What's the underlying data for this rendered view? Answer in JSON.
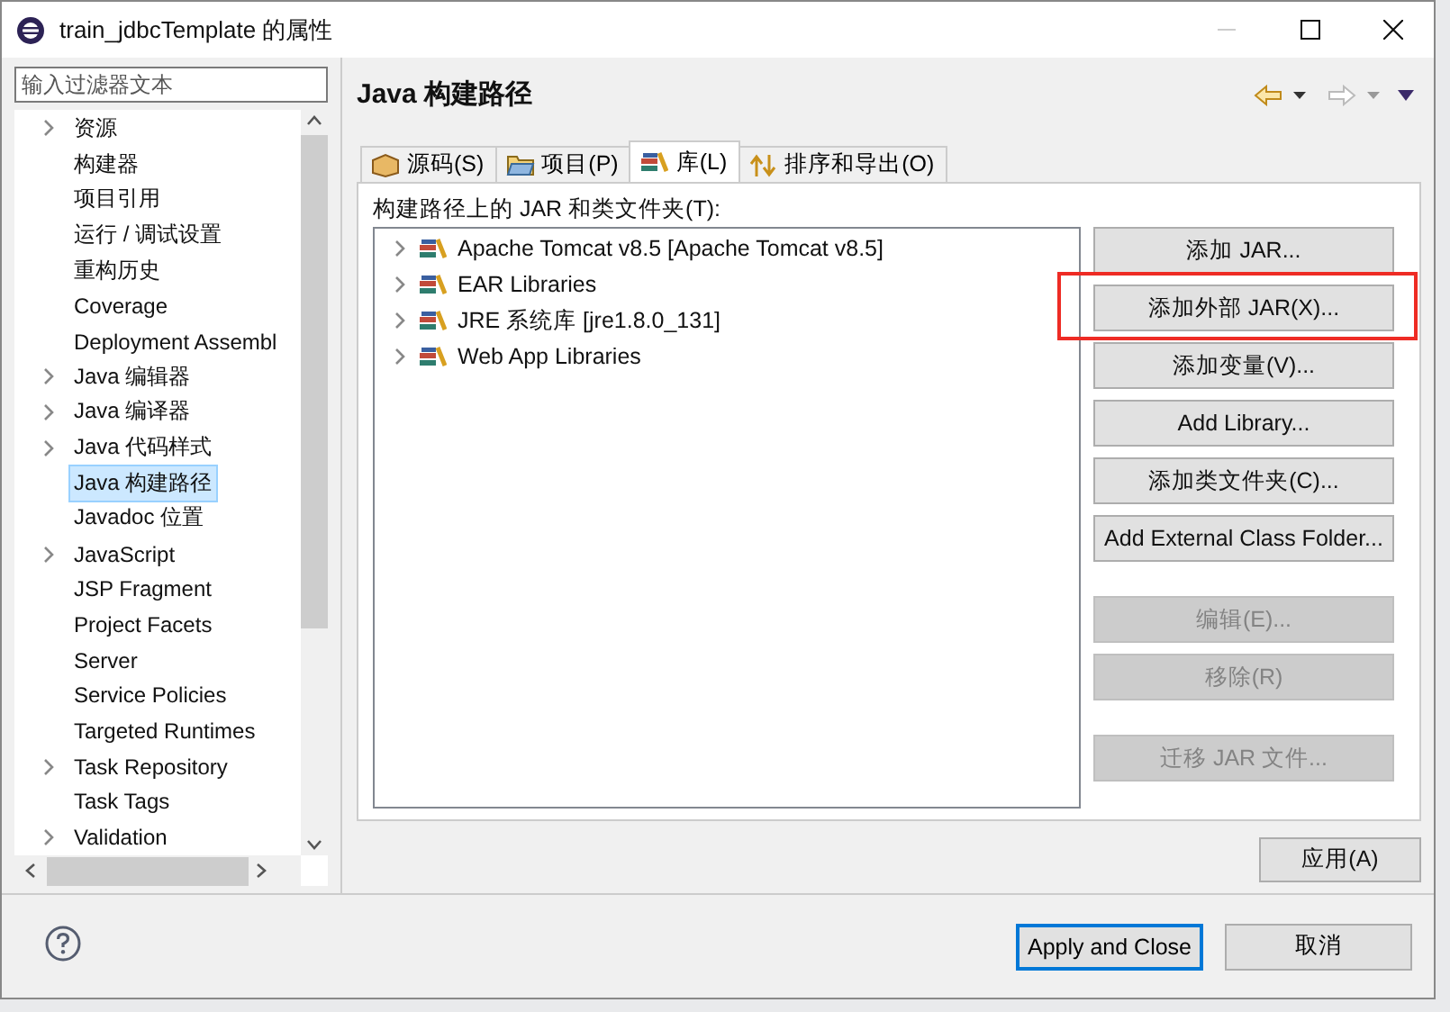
{
  "window": {
    "title": "train_jdbcTemplate 的属性"
  },
  "filter": {
    "placeholder": "输入过滤器文本"
  },
  "tree": {
    "items": [
      {
        "label": "资源",
        "expandable": true,
        "selected": false
      },
      {
        "label": "构建器",
        "expandable": false,
        "selected": false
      },
      {
        "label": "项目引用",
        "expandable": false,
        "selected": false
      },
      {
        "label": "运行 / 调试设置",
        "expandable": false,
        "selected": false
      },
      {
        "label": "重构历史",
        "expandable": false,
        "selected": false
      },
      {
        "label": "Coverage",
        "expandable": false,
        "selected": false
      },
      {
        "label": "Deployment Assembl",
        "expandable": false,
        "selected": false
      },
      {
        "label": "Java 编辑器",
        "expandable": true,
        "selected": false
      },
      {
        "label": "Java 编译器",
        "expandable": true,
        "selected": false
      },
      {
        "label": "Java 代码样式",
        "expandable": true,
        "selected": false
      },
      {
        "label": "Java 构建路径",
        "expandable": false,
        "selected": true
      },
      {
        "label": "Javadoc 位置",
        "expandable": false,
        "selected": false
      },
      {
        "label": "JavaScript",
        "expandable": true,
        "selected": false
      },
      {
        "label": "JSP Fragment",
        "expandable": false,
        "selected": false
      },
      {
        "label": "Project Facets",
        "expandable": false,
        "selected": false
      },
      {
        "label": "Server",
        "expandable": false,
        "selected": false
      },
      {
        "label": "Service Policies",
        "expandable": false,
        "selected": false
      },
      {
        "label": "Targeted Runtimes",
        "expandable": false,
        "selected": false
      },
      {
        "label": "Task Repository",
        "expandable": true,
        "selected": false
      },
      {
        "label": "Task Tags",
        "expandable": false,
        "selected": false
      },
      {
        "label": "Validation",
        "expandable": true,
        "selected": false
      }
    ]
  },
  "page": {
    "title": "Java 构建路径"
  },
  "tabs": [
    {
      "label": "源码(S)",
      "selected": false
    },
    {
      "label": "项目(P)",
      "selected": false
    },
    {
      "label": "库(L)",
      "selected": true
    },
    {
      "label": "排序和导出(O)",
      "selected": false
    }
  ],
  "libraries": {
    "label": "构建路径上的 JAR 和类文件夹(T):",
    "items": [
      {
        "label": "Apache Tomcat v8.5 [Apache Tomcat v8.5]",
        "expandable": true
      },
      {
        "label": "EAR Libraries",
        "expandable": true
      },
      {
        "label": "JRE 系统库 [jre1.8.0_131]",
        "expandable": true
      },
      {
        "label": "Web App Libraries",
        "expandable": true
      }
    ]
  },
  "button_groups": [
    [
      {
        "label": "添加 JAR...",
        "disabled": false,
        "highlighted": false
      },
      {
        "label": "添加外部 JAR(X)...",
        "disabled": false,
        "highlighted": true
      },
      {
        "label": "添加变量(V)...",
        "disabled": false,
        "highlighted": false
      },
      {
        "label": "Add Library...",
        "disabled": false,
        "highlighted": false
      },
      {
        "label": "添加类文件夹(C)...",
        "disabled": false,
        "highlighted": false
      },
      {
        "label": "Add External Class Folder...",
        "disabled": false,
        "highlighted": false
      }
    ],
    [
      {
        "label": "编辑(E)...",
        "disabled": true,
        "highlighted": false
      },
      {
        "label": "移除(R)",
        "disabled": true,
        "highlighted": false
      }
    ],
    [
      {
        "label": "迁移 JAR 文件...",
        "disabled": true,
        "highlighted": false
      }
    ]
  ],
  "apply_button": {
    "label": "应用(A)"
  },
  "footer_buttons": [
    {
      "label": "Apply and Close",
      "default": true
    },
    {
      "label": "取消",
      "default": false
    }
  ]
}
